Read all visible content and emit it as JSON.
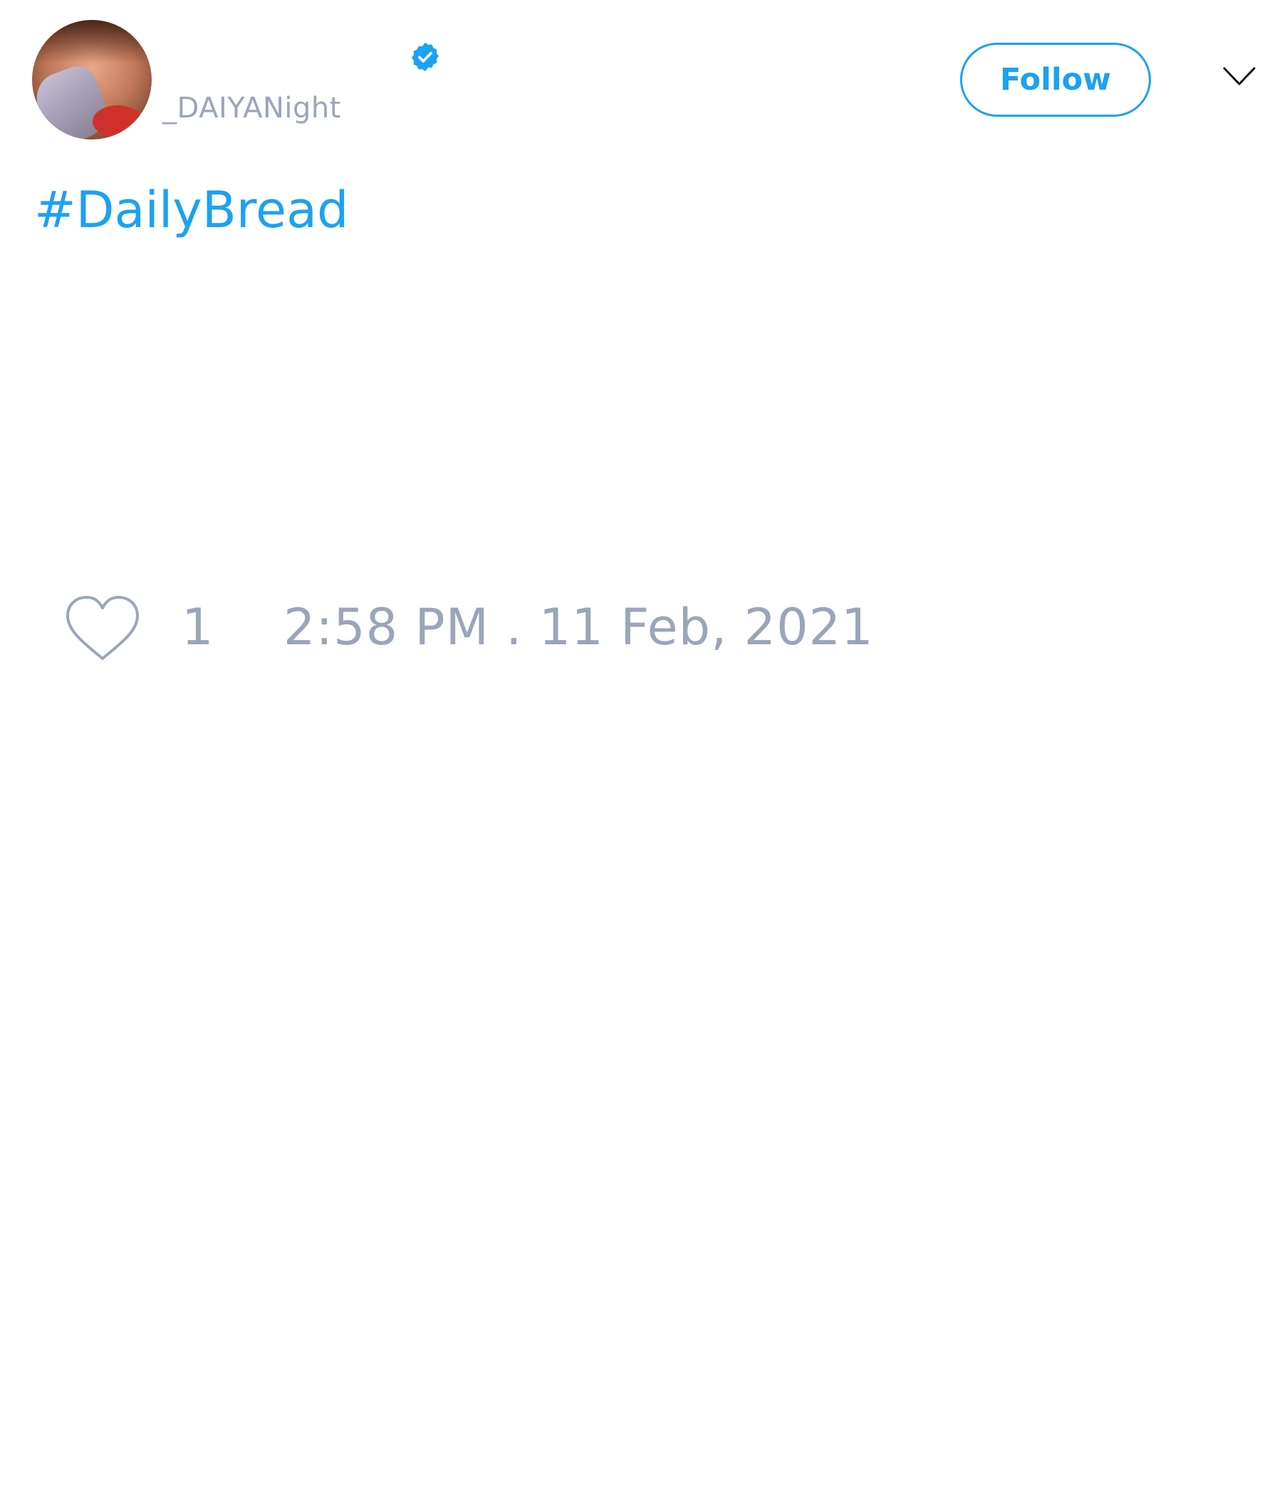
{
  "tweet": {
    "author": {
      "handle": "_DAIYANight",
      "verified": true,
      "avatar": "profile-photo"
    },
    "follow_label": "Follow",
    "text": "#DailyBread",
    "likes": "1",
    "timestamp": "2:58 PM . 11 Feb, 2021"
  },
  "icons": {
    "verified": "verified-badge-icon",
    "menu": "chevron-down-icon",
    "like": "heart-icon"
  },
  "colors": {
    "accent": "#1da1f2",
    "muted": "#9aa6b8",
    "background": "#ffffff"
  }
}
